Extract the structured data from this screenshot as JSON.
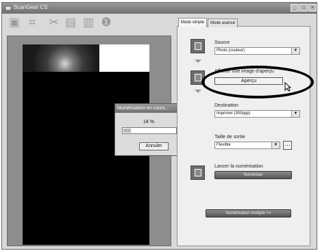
{
  "window": {
    "title": "ScanGear CS",
    "controls": [
      "minimize-icon",
      "maximize-icon",
      "close-icon"
    ]
  },
  "toolbar": {
    "tools": [
      {
        "name": "thumbnail-icon",
        "glyph": "▣"
      },
      {
        "name": "crop-icon",
        "glyph": "⌗"
      },
      {
        "name": "auto-crop-icon",
        "glyph": "✂"
      },
      {
        "name": "scan-to-folder-icon",
        "glyph": "▤"
      },
      {
        "name": "clear-icon",
        "glyph": "▥"
      },
      {
        "name": "info-icon",
        "glyph": "❶"
      }
    ]
  },
  "tabs": {
    "simple": "Mode simple",
    "advanced": "Mode avancé"
  },
  "source": {
    "label": "Source",
    "value": "Photo (couleur)"
  },
  "preview_step": {
    "label": "Afficher une image d'aperçu",
    "button": "Aperçu"
  },
  "destination": {
    "label": "Destination",
    "value": "Imprimer (300ppp)"
  },
  "output_size": {
    "label": "Taille de sortie",
    "value": "Flexible"
  },
  "scan_step": {
    "label": "Lancer la numérisation",
    "button": "Numériser"
  },
  "multi_scan_button": "Numérisation multiple >>",
  "progress_dialog": {
    "title": "Numérisation en cours...",
    "percent": "14 %",
    "progress": 0.14,
    "cancel": "Annuler"
  }
}
